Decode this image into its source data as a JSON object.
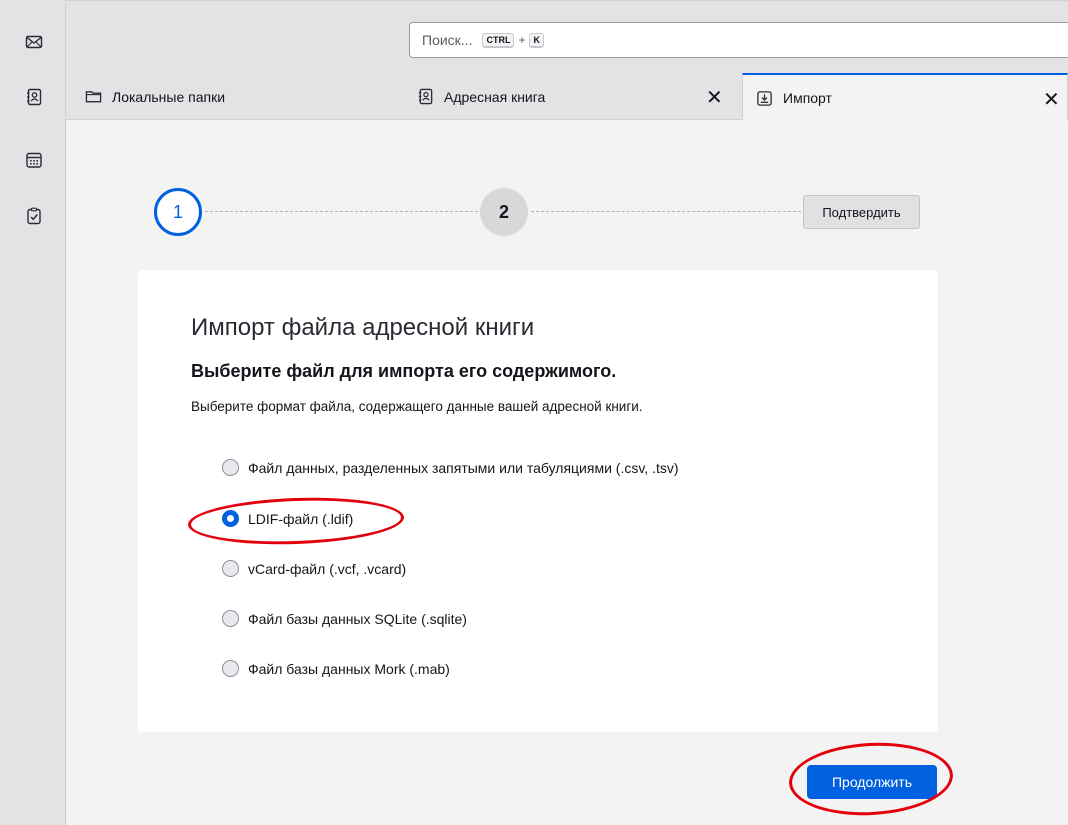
{
  "toolbar": {
    "search_placeholder": "Поиск...",
    "kbd_ctrl": "CTRL",
    "kbd_plus": "+",
    "kbd_key": "K"
  },
  "spaces": [
    {
      "icon": "mail-icon"
    },
    {
      "icon": "address-book-icon"
    },
    {
      "icon": "calendar-icon"
    },
    {
      "icon": "tasks-icon"
    }
  ],
  "tabs": [
    {
      "label": "Локальные папки",
      "icon": "folder-icon"
    },
    {
      "label": "Адресная книга",
      "icon": "address-book-icon",
      "close": "✕"
    },
    {
      "label": "Импорт",
      "icon": "import-icon",
      "close": "✕",
      "selected": true
    }
  ],
  "stepper": {
    "step1": "1",
    "step2": "2",
    "confirm_label": "Подтвердить"
  },
  "card": {
    "title": "Импорт файла адресной книги",
    "subtitle": "Выберите файл для импорта его содержимого.",
    "description": "Выберите формат файла, содержащего данные вашей адресной книги.",
    "options": [
      {
        "label": "Файл данных, разделенных запятыми или табуляциями (.csv, .tsv)",
        "checked": false
      },
      {
        "label": "LDIF-файл (.ldif)",
        "checked": true
      },
      {
        "label": "vCard-файл (.vcf, .vcard)",
        "checked": false
      },
      {
        "label": "Файл базы данных SQLite (.sqlite)",
        "checked": false
      },
      {
        "label": "Файл базы данных Mork (.mab)",
        "checked": false
      }
    ]
  },
  "continue_label": "Продолжить",
  "colors": {
    "accent": "#0061e0",
    "annotation": "#e3000b"
  }
}
